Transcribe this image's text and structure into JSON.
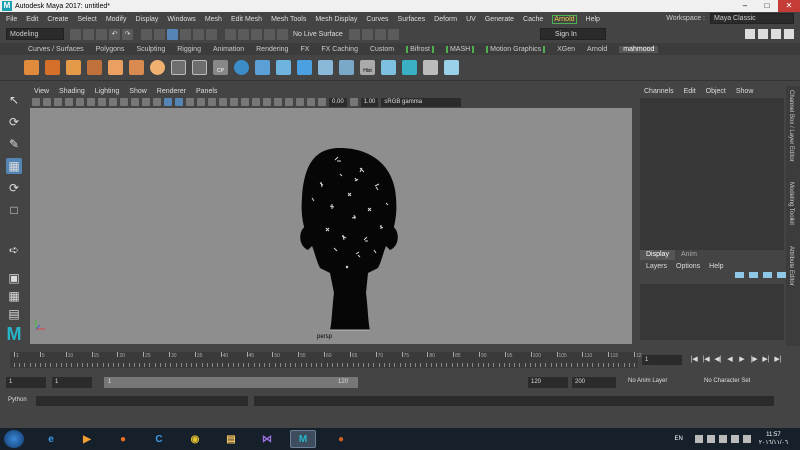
{
  "window": {
    "title": "Autodesk Maya 2017: untitled*",
    "logo_letter": "M"
  },
  "menubar": {
    "items": [
      "File",
      "Edit",
      "Create",
      "Select",
      "Modify",
      "Display",
      "Windows",
      "Mesh",
      "Edit Mesh",
      "Mesh Tools",
      "Mesh Display",
      "Curves",
      "Surfaces",
      "Deform",
      "UV",
      "Generate",
      "Cache",
      "Arnold",
      "Help"
    ],
    "workspace_label": "Workspace :",
    "workspace_value": "Maya Classic"
  },
  "statusline": {
    "mode": "Modeling",
    "live_surface": "No Live Surface",
    "sign_in": "Sign In"
  },
  "shelf": {
    "tabs": [
      "Curves / Surfaces",
      "Polygons",
      "Sculpting",
      "Rigging",
      "Animation",
      "Rendering",
      "FX",
      "FX Caching",
      "Custom",
      "Bifrost",
      "MASH",
      "Motion Graphics",
      "XGen",
      "Arnold",
      "mahmood"
    ],
    "active_tab": "mahmood",
    "icon_labels": {
      "cp": "CP",
      "hist": "Hist"
    }
  },
  "viewport": {
    "menus": [
      "View",
      "Shading",
      "Lighting",
      "Show",
      "Renderer",
      "Panels"
    ],
    "exposure": "0.00",
    "gamma": "1.00",
    "color_space": "sRGB gamma",
    "camera": "persp"
  },
  "channel_box": {
    "menus": [
      "Channels",
      "Edit",
      "Object",
      "Show"
    ]
  },
  "layer_editor": {
    "tabs": [
      "Display",
      "Anim"
    ],
    "active_tab": "Display",
    "menus": [
      "Layers",
      "Options",
      "Help"
    ]
  },
  "side_tabs": [
    "Channel Box / Layer Editor",
    "Modeling Toolkit",
    "Attribute Editor"
  ],
  "time_slider": {
    "ticks": [
      "1",
      "5",
      "10",
      "15",
      "20",
      "25",
      "30",
      "35",
      "40",
      "45",
      "50",
      "55",
      "60",
      "65",
      "70",
      "75",
      "80",
      "85",
      "90",
      "95",
      "100",
      "105",
      "110",
      "115",
      "12"
    ],
    "current_frame": "1"
  },
  "range_slider": {
    "start_field": "1",
    "start_field2": "1",
    "range_start": "1",
    "range_end": "120",
    "end_field": "120",
    "end_field2": "200",
    "anim_layer": "No Anim Layer",
    "character_set": "No Character Set"
  },
  "command_line": {
    "language": "Python"
  },
  "taskbar": {
    "lang": "EN",
    "time": "11:57",
    "date": "٢٠١٦/١١/٠٦"
  }
}
